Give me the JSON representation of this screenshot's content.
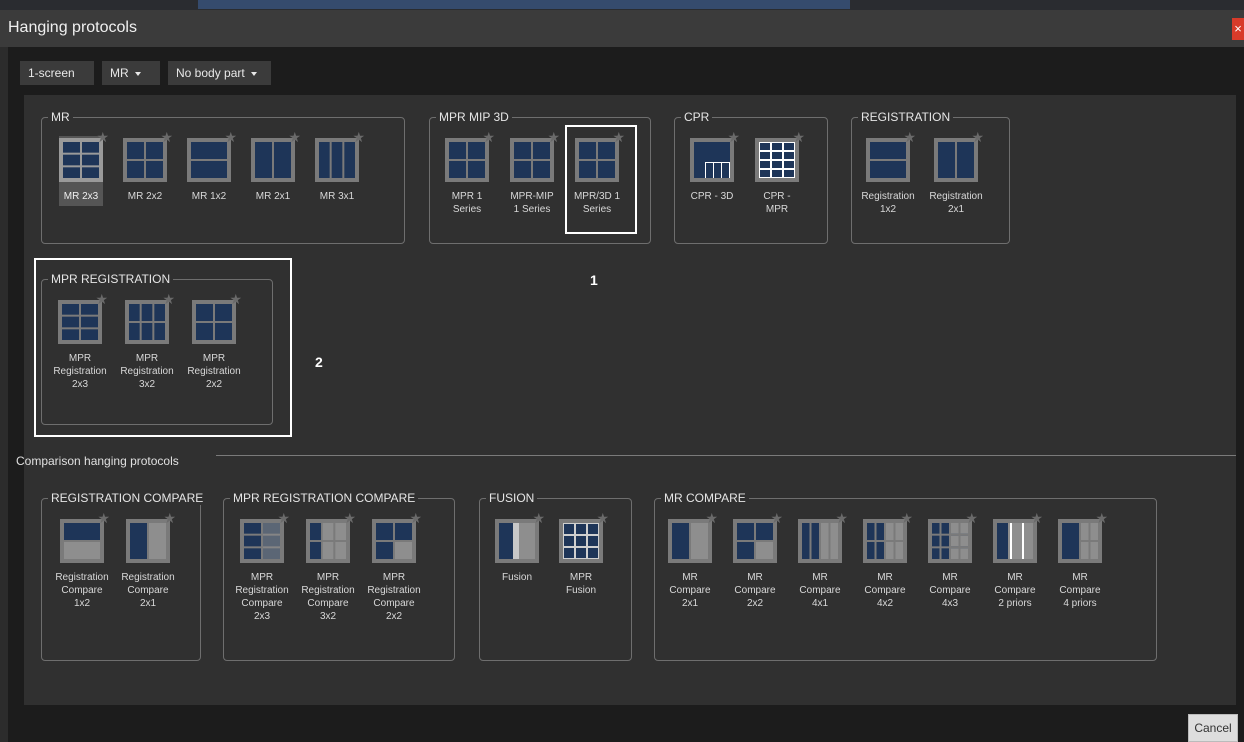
{
  "window": {
    "title": "Hanging protocols",
    "close_glyph": "×"
  },
  "toolbar": {
    "screens": "1-screen",
    "modality": "MR",
    "body_part": "No body part"
  },
  "groups": [
    {
      "title": "MR",
      "items": [
        {
          "label": "MR 2x3",
          "layout": "2x3",
          "selected": true
        },
        {
          "label": "MR 2x2",
          "layout": "2x2"
        },
        {
          "label": "MR 1x2",
          "layout": "1x2"
        },
        {
          "label": "MR 2x1",
          "layout": "2x1"
        },
        {
          "label": "MR 3x1",
          "layout": "3x1"
        }
      ]
    },
    {
      "title": "MPR MIP 3D",
      "items": [
        {
          "label": "MPR 1\nSeries",
          "layout": "2x2"
        },
        {
          "label": "MPR-MIP\n1 Series",
          "layout": "2x2"
        },
        {
          "label": "MPR/3D 1\nSeries",
          "layout": "2x2"
        }
      ]
    },
    {
      "title": "CPR",
      "items": [
        {
          "label": "CPR - 3D",
          "layout": "cpr3d"
        },
        {
          "label": "CPR -\nMPR",
          "layout": "cprmpr"
        }
      ]
    },
    {
      "title": "REGISTRATION",
      "items": [
        {
          "label": "Registration\n1x2",
          "layout": "1x2"
        },
        {
          "label": "Registration\n2x1",
          "layout": "2x1"
        }
      ]
    },
    {
      "title": "MPR REGISTRATION",
      "items": [
        {
          "label": "MPR\nRegistration\n2x3",
          "layout": "2x3"
        },
        {
          "label": "MPR\nRegistration\n3x2",
          "layout": "3x2"
        },
        {
          "label": "MPR\nRegistration\n2x2",
          "layout": "2x2"
        }
      ]
    }
  ],
  "comparison_label": "Comparison hanging protocols",
  "comparison_groups": [
    {
      "title": "REGISTRATION COMPARE",
      "items": [
        {
          "label": "Registration\nCompare\n1x2",
          "layout": "cmp1x2"
        },
        {
          "label": "Registration\nCompare\n2x1",
          "layout": "cmp2x1"
        }
      ]
    },
    {
      "title": "MPR REGISTRATION COMPARE",
      "items": [
        {
          "label": "MPR\nRegistration\nCompare\n2x3",
          "layout": "cmp2x3"
        },
        {
          "label": "MPR\nRegistration\nCompare\n3x2",
          "layout": "cmp3x2"
        },
        {
          "label": "MPR\nRegistration\nCompare\n2x2",
          "layout": "cmp2x2"
        }
      ]
    },
    {
      "title": "FUSION",
      "items": [
        {
          "label": "Fusion",
          "layout": "fusion"
        },
        {
          "label": "MPR\nFusion",
          "layout": "mprfusion"
        }
      ]
    },
    {
      "title": "MR COMPARE",
      "items": [
        {
          "label": "MR\nCompare\n2x1",
          "layout": "cmp2x1"
        },
        {
          "label": "MR\nCompare\n2x2",
          "layout": "cmp2x2"
        },
        {
          "label": "MR\nCompare\n4x1",
          "layout": "cmp4x1"
        },
        {
          "label": "MR\nCompare\n4x2",
          "layout": "cmp4x2"
        },
        {
          "label": "MR\nCompare\n4x3",
          "layout": "cmp4x3"
        },
        {
          "label": "MR\nCompare\n2 priors",
          "layout": "priors2"
        },
        {
          "label": "MR\nCompare\n4 priors",
          "layout": "priors4"
        }
      ]
    }
  ],
  "annotations": {
    "marker1": "1",
    "marker2": "2"
  },
  "footer": {
    "cancel": "Cancel"
  },
  "icons": {
    "favorite": "star-icon"
  },
  "colors": {
    "tile_dark": "#1e3558",
    "tile_light": "#8e8e8e",
    "frame": "#7a7a7a",
    "close": "#d83b2a"
  }
}
